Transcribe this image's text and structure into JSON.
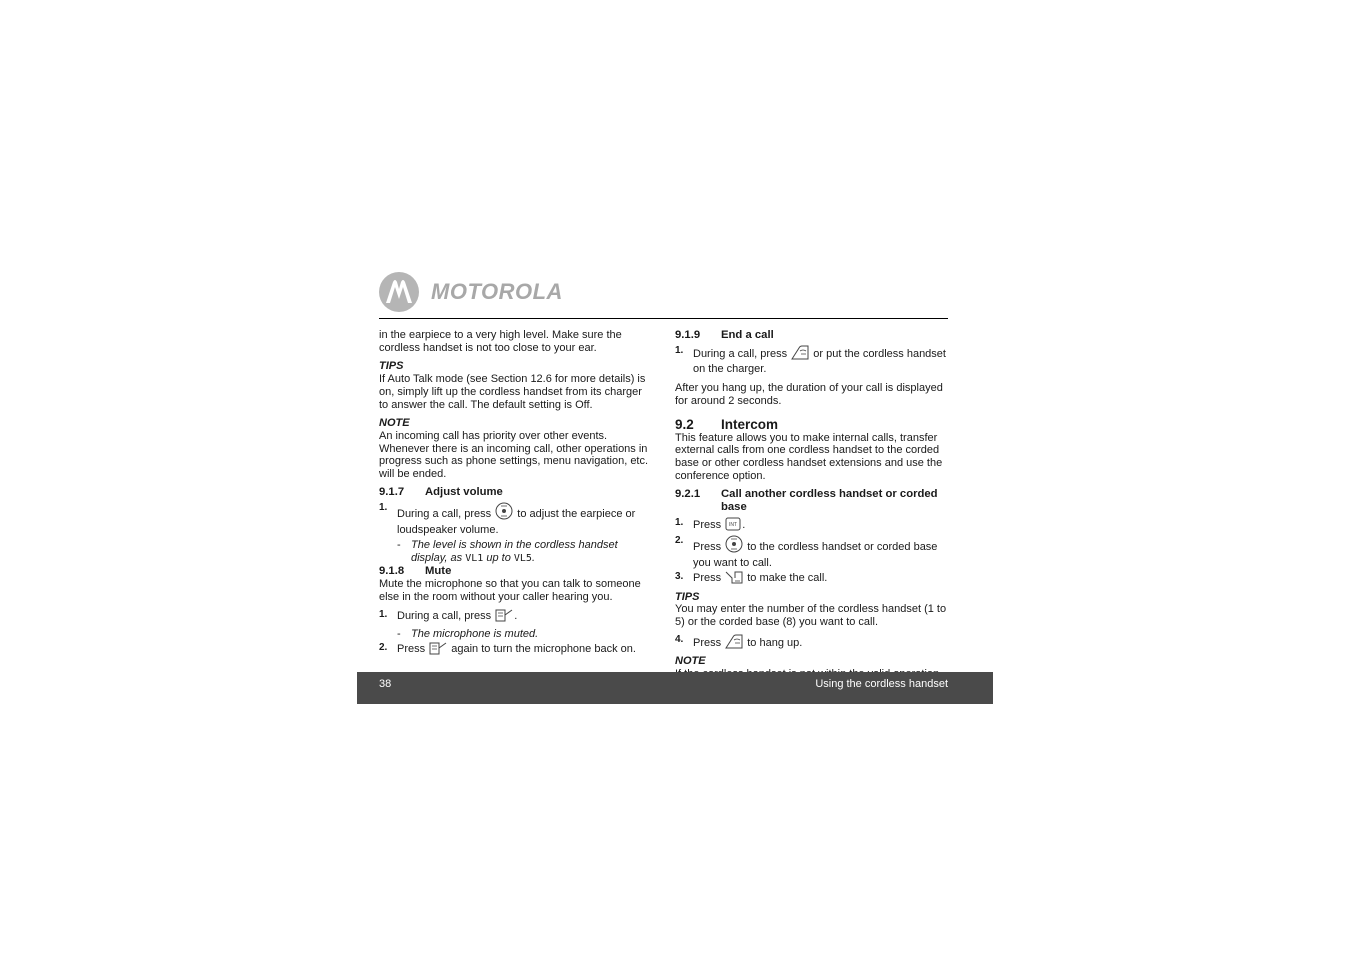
{
  "brand": {
    "name": "MOTOROLA",
    "logo_icon": "motorola-batwing-logo"
  },
  "left_column": {
    "intro": "in the earpiece to a very high level. Make sure the cordless handset is not too close to your ear.",
    "tips1": {
      "label": "TIPS",
      "text": "If Auto Talk mode (see Section 12.6 for more details) is on, simply lift up the cordless handset from its charger to answer the call. The default setting is Off."
    },
    "note1": {
      "label": "NOTE",
      "text": "An incoming call has priority over other events. Whenever there is an incoming call, other operations in progress such as phone settings, menu navigation, etc. will be ended."
    },
    "s917": {
      "number": "9.1.7",
      "title": "Adjust volume",
      "step1": {
        "n": "1.",
        "before": "During a call, press",
        "icon": "navigation-key-icon",
        "after": "to adjust the earpiece or loudspeaker volume."
      },
      "sub1": {
        "dash": "-",
        "before": "The level is shown in the cordless handset display, as",
        "lcd1": "VL1",
        "mid": "up to",
        "lcd2": "VL5",
        "after": "."
      }
    },
    "s918": {
      "number": "9.1.8",
      "title": "Mute",
      "intro": "Mute the microphone so that you can talk to someone else in the room without your caller hearing you.",
      "step1": {
        "n": "1.",
        "before": "During a call, press",
        "icon": "mute-softkey-icon",
        "after": "."
      },
      "sub1": {
        "dash": "-",
        "text": "The microphone is muted."
      },
      "step2": {
        "n": "2.",
        "before": "Press",
        "icon": "mute-softkey-icon",
        "after": "again to turn the microphone back on."
      }
    }
  },
  "right_column": {
    "s919": {
      "number": "9.1.9",
      "title": "End a call",
      "step1": {
        "n": "1.",
        "before": "During a call, press",
        "icon": "end-call-key-icon",
        "after": "or put the cordless handset on the charger."
      },
      "after_text": "After you hang up, the duration of your call is displayed for around 2 seconds."
    },
    "s92": {
      "number": "9.2",
      "title": "Intercom",
      "intro": "This feature allows you to make internal calls, transfer external calls from one cordless handset to the corded base or other cordless handset extensions and use the conference option."
    },
    "s921": {
      "number": "9.2.1",
      "title": "Call another cordless handset or corded base",
      "step1": {
        "n": "1.",
        "before": "Press",
        "icon": "intercom-key-icon",
        "after": "."
      },
      "step2": {
        "n": "2.",
        "before": "Press",
        "icon": "navigation-key-icon",
        "after": "to the cordless handset or corded base you want to call."
      },
      "step3": {
        "n": "3.",
        "before": "Press",
        "icon": "talk-key-icon",
        "after": "to make the call."
      },
      "tips": {
        "label": "TIPS",
        "text": "You may enter the number of the cordless handset (1 to 5) or the corded base (8) you want to call."
      },
      "step4": {
        "n": "4.",
        "before": "Press",
        "icon": "end-call-key-icon",
        "after": "to hang up."
      },
      "note": {
        "label": "NOTE",
        "text": "If the cordless handset is not within the valid operation range, this function may not be available."
      }
    }
  },
  "footer": {
    "page_number": "38",
    "section_title": "Using the cordless handset",
    "background": "#4a4a4a"
  }
}
